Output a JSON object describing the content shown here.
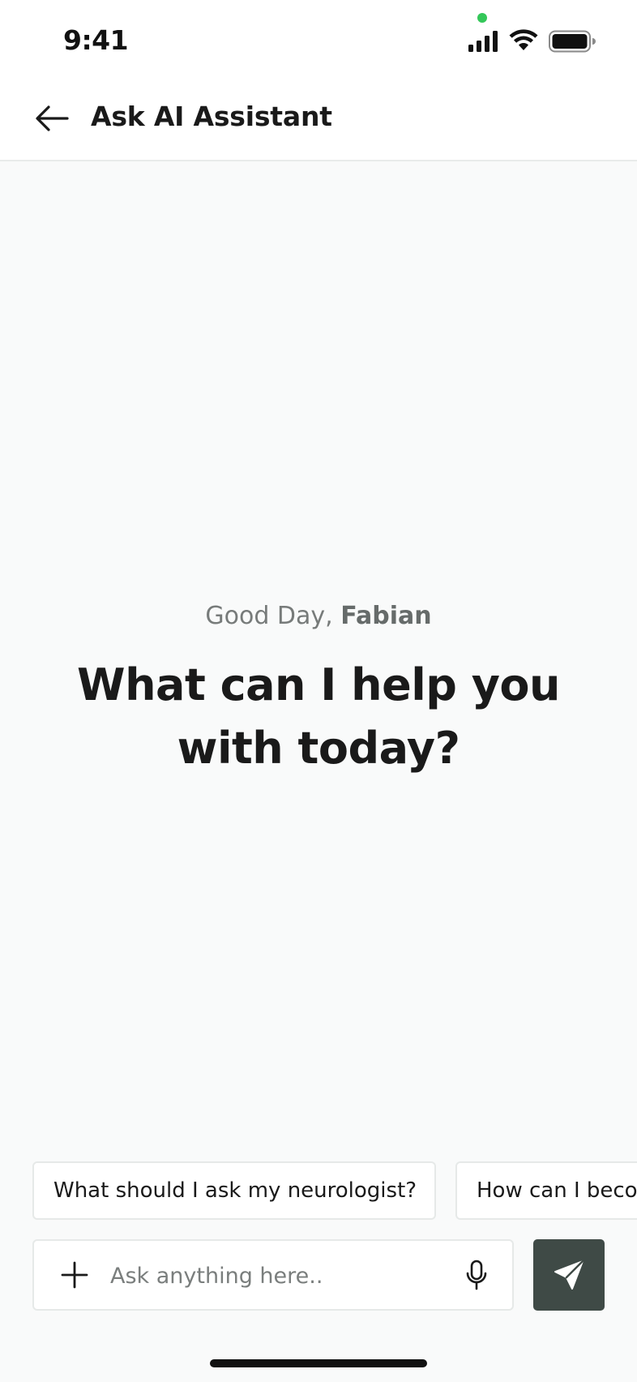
{
  "status_bar": {
    "time": "9:41",
    "icons": [
      "signal-icon",
      "wifi-icon",
      "battery-icon"
    ],
    "indicator_color": "#34c759"
  },
  "header": {
    "title": "Ask AI Assistant",
    "back_icon": "arrow-left-icon"
  },
  "greeting": {
    "prefix": "Good Day, ",
    "name": "Fabian",
    "headline": "What can I help you with today?"
  },
  "suggestions": [
    {
      "label": "What should I ask my neurologist?"
    },
    {
      "label": "How can I beco"
    }
  ],
  "composer": {
    "placeholder": "Ask anything here..",
    "value": "",
    "add_icon": "plus-icon",
    "mic_icon": "microphone-icon",
    "send_icon": "send-icon",
    "send_color": "#3f4a46"
  }
}
